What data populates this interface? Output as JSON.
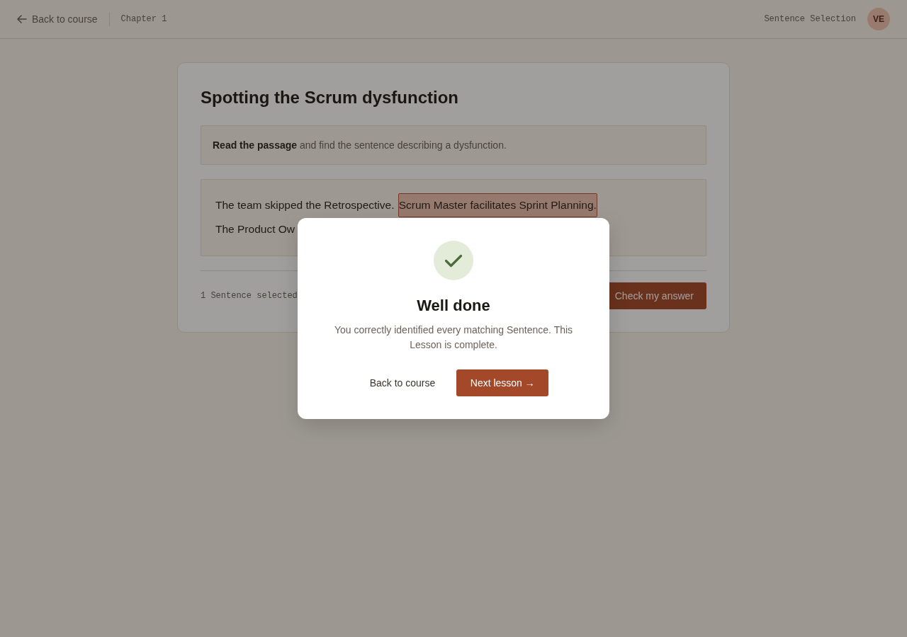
{
  "header": {
    "back_link": "Back to course",
    "chapter": "Chapter 1",
    "exercise_type": "Sentence Selection",
    "avatar_initials": "VE"
  },
  "exercise": {
    "title": "Spotting the Scrum dysfunction",
    "instruction": "**Read the passage** and find the sentence describing a dysfunction.",
    "sentences": [
      {
        "text": "The team skipped the Retrospective.",
        "selected": false
      },
      {
        "text": "Scrum Master facilitates Sprint Planning.",
        "selected": true
      },
      {
        "text": "The Product Ow",
        "selected": false
      }
    ],
    "selection_count": "1 Sentence selected",
    "check_button": "Check my answer"
  },
  "dialog": {
    "title": "Well done",
    "message": "You correctly identified every matching Sentence. This Lesson is complete.",
    "secondary_button": "Back to course",
    "primary_button": "Next lesson →"
  }
}
